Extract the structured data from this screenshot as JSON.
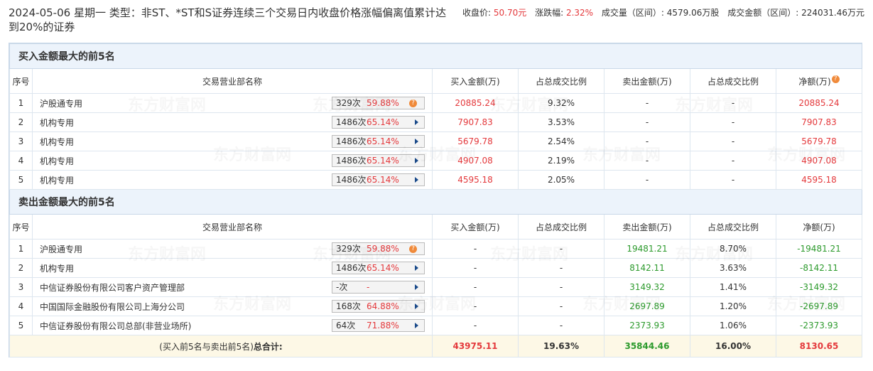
{
  "header": {
    "title": "2024-05-06 星期一 类型：非ST、*ST和S证券连续三个交易日内收盘价格涨幅偏离值累计达到20%的证券",
    "close_label": "收盘价:",
    "close_value": "50.70元",
    "change_label": "涨跌幅:",
    "change_value": "2.32%",
    "volume_label": "成交量（区间）:",
    "volume_value": "4579.06万股",
    "amount_label": "成交金额（区间）:",
    "amount_value": "224031.46万元"
  },
  "buy_section": {
    "title": "买入金额最大的前5名",
    "headers": [
      "序号",
      "交易营业部名称",
      "买入金额(万)",
      "占总成交比例",
      "卖出金额(万)",
      "占总成交比例",
      "净额(万)"
    ],
    "rows": [
      {
        "no": "1",
        "name": "沪股通专用",
        "count": "329次",
        "pct": "59.88%",
        "icon": "question-icon",
        "buy": "20885.24",
        "buy_ratio": "9.32%",
        "sell": "-",
        "sell_ratio": "-",
        "net": "20885.24"
      },
      {
        "no": "2",
        "name": "机构专用",
        "count": "1486次",
        "pct": "65.14%",
        "icon": "arrow-right-icon",
        "buy": "7907.83",
        "buy_ratio": "3.53%",
        "sell": "-",
        "sell_ratio": "-",
        "net": "7907.83"
      },
      {
        "no": "3",
        "name": "机构专用",
        "count": "1486次",
        "pct": "65.14%",
        "icon": "arrow-right-icon",
        "buy": "5679.78",
        "buy_ratio": "2.54%",
        "sell": "-",
        "sell_ratio": "-",
        "net": "5679.78"
      },
      {
        "no": "4",
        "name": "机构专用",
        "count": "1486次",
        "pct": "65.14%",
        "icon": "arrow-right-icon",
        "buy": "4907.08",
        "buy_ratio": "2.19%",
        "sell": "-",
        "sell_ratio": "-",
        "net": "4907.08"
      },
      {
        "no": "5",
        "name": "机构专用",
        "count": "1486次",
        "pct": "65.14%",
        "icon": "arrow-right-icon",
        "buy": "4595.18",
        "buy_ratio": "2.05%",
        "sell": "-",
        "sell_ratio": "-",
        "net": "4595.18"
      }
    ]
  },
  "sell_section": {
    "title": "卖出金额最大的前5名",
    "headers": [
      "序号",
      "交易营业部名称",
      "买入金额(万)",
      "占总成交比例",
      "卖出金额(万)",
      "占总成交比例",
      "净额(万)"
    ],
    "rows": [
      {
        "no": "1",
        "name": "沪股通专用",
        "count": "329次",
        "pct": "59.88%",
        "icon": "question-icon",
        "buy": "-",
        "buy_ratio": "-",
        "sell": "19481.21",
        "sell_ratio": "8.70%",
        "net": "-19481.21"
      },
      {
        "no": "2",
        "name": "机构专用",
        "count": "1486次",
        "pct": "65.14%",
        "icon": "arrow-right-icon",
        "buy": "-",
        "buy_ratio": "-",
        "sell": "8142.11",
        "sell_ratio": "3.63%",
        "net": "-8142.11"
      },
      {
        "no": "3",
        "name": "中信证券股份有限公司客户资产管理部",
        "count": "-次",
        "pct": "-",
        "icon": "arrow-right-icon",
        "buy": "-",
        "buy_ratio": "-",
        "sell": "3149.32",
        "sell_ratio": "1.41%",
        "net": "-3149.32"
      },
      {
        "no": "4",
        "name": "中国国际金融股份有限公司上海分公司",
        "count": "168次",
        "pct": "64.88%",
        "icon": "arrow-right-icon",
        "buy": "-",
        "buy_ratio": "-",
        "sell": "2697.89",
        "sell_ratio": "1.20%",
        "net": "-2697.89"
      },
      {
        "no": "5",
        "name": "中信证券股份有限公司总部(非营业场所)",
        "count": "64次",
        "pct": "71.88%",
        "icon": "arrow-right-icon",
        "buy": "-",
        "buy_ratio": "-",
        "sell": "2373.93",
        "sell_ratio": "1.06%",
        "net": "-2373.93"
      }
    ]
  },
  "total": {
    "label_prefix": "(买入前5名与卖出前5名)",
    "label_bold": "总合计:",
    "buy": "43975.11",
    "buy_ratio": "19.63%",
    "sell": "35844.46",
    "sell_ratio": "16.00%",
    "net": "8130.65"
  },
  "watermark": "东方财富网",
  "colors": {
    "red": "#e4393c",
    "green": "#2c9a2c",
    "section_bg": "#ecf3fb",
    "total_bg": "#fdf8e6"
  }
}
